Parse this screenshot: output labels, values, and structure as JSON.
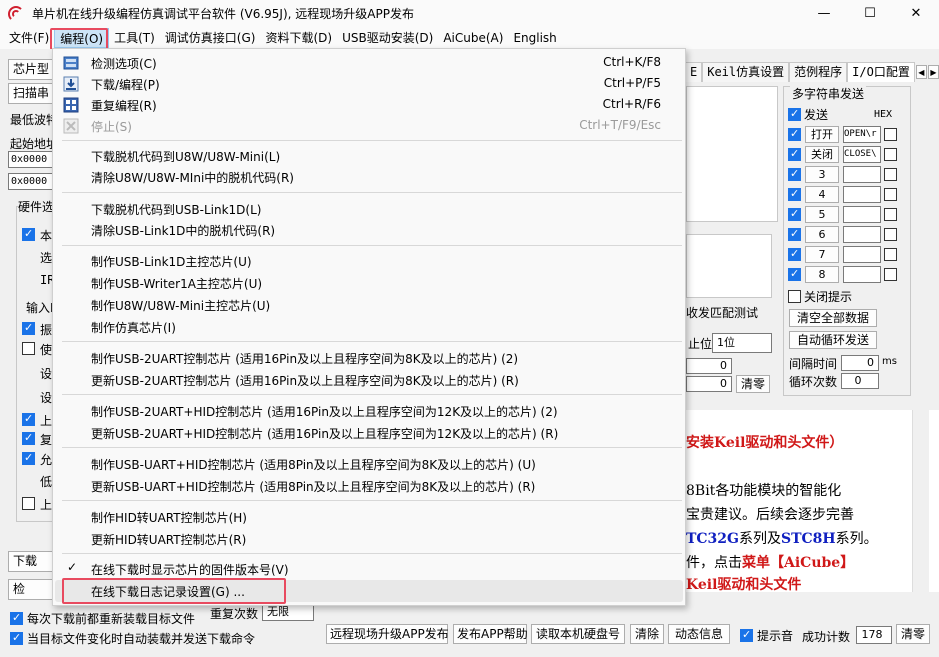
{
  "window": {
    "title": "单片机在线升级编程仿真调试平台软件 (V6.95J), 远程现场升级APP发布",
    "minimize_glyph": "—",
    "maximize_glyph": "☐",
    "close_glyph": "✕"
  },
  "menubar": [
    {
      "label": "文件(F)"
    },
    {
      "label": "编程(O)"
    },
    {
      "label": "工具(T)"
    },
    {
      "label": "调试仿真接口(G)"
    },
    {
      "label": "资料下载(D)"
    },
    {
      "label": "USB驱动安装(D)"
    },
    {
      "label": "AiCube(A)"
    },
    {
      "label": "English"
    }
  ],
  "left_panel": {
    "chip_label": "芯片型",
    "scan_label": "扫描串",
    "min_baud": "最低波特",
    "start_addr": "起始地址",
    "addr1": "0x0000",
    "addr2": "0x0000",
    "hw_group": "硬件选",
    "fragments": [
      "本",
      "选",
      "IR",
      "输入I",
      "振",
      "使",
      "设",
      "设",
      "上",
      "复",
      "允",
      "低",
      "上"
    ],
    "download_btn": "下载",
    "check_btn": "检"
  },
  "tabs": [
    "E",
    "Keil仿真设置",
    "范例程序",
    "I/O口配置"
  ],
  "tab_arrows": [
    "◀",
    "▶"
  ],
  "multistring": {
    "title": "多字符串发送",
    "send_label": "发送",
    "hex_label": "HEX",
    "rows": [
      {
        "btn": "打开",
        "value": "OPEN\\r"
      },
      {
        "btn": "关闭",
        "value": "CLOSE\\"
      },
      {
        "btn": "3",
        "value": ""
      },
      {
        "btn": "4",
        "value": ""
      },
      {
        "btn": "5",
        "value": ""
      },
      {
        "btn": "6",
        "value": ""
      },
      {
        "btn": "7",
        "value": ""
      },
      {
        "btn": "8",
        "value": ""
      }
    ],
    "close_hint": "关闭提示",
    "clear_all": "清空全部数据",
    "auto_loop": "自动循环发送",
    "interval_label": "间隔时间",
    "interval_value": "0",
    "interval_unit": "ms",
    "loop_label": "循环次数",
    "loop_value": "0"
  },
  "middle_right": {
    "trigger_text": "收发匹配测试",
    "stopbit_label": "止位",
    "stopbit_value": "1位",
    "count1": "0",
    "count2": "0",
    "clear": "清零"
  },
  "info": {
    "line1": "安装Keil驱动和头文件）",
    "line2": "8Bit各功能模块的智能化",
    "line3": "宝贵建议。后续会逐步完善",
    "line4_a": "TC32G",
    "line4_b": "系列及",
    "line4_c": "STC8H",
    "line4_d": "系列。",
    "line5_a": "件，点击",
    "line5_b": "菜单【AiCube】",
    "line6": "Keil驱动和头文件"
  },
  "bottom": {
    "reload_each": "每次下载前都重新装载目标文件",
    "auto_reload": "当目标文件变化时自动装载并发送下载命令",
    "repeat_label": "重复次数",
    "repeat_value": "无限",
    "buttons": [
      "远程现场升级APP发布",
      "发布APP帮助",
      "读取本机硬盘号",
      "清除",
      "动态信息"
    ],
    "beep": "提示音",
    "success_label": "成功计数",
    "success_value": "178",
    "clear": "清零"
  },
  "dropdown": {
    "items": [
      {
        "label": "检测选项(C)",
        "shortcut": "Ctrl+K/F8",
        "icon": "check-options-icon"
      },
      {
        "label": "下载/编程(P)",
        "shortcut": "Ctrl+P/F5",
        "icon": "download-icon"
      },
      {
        "label": "重复编程(R)",
        "shortcut": "Ctrl+R/F6",
        "icon": "repeat-program-icon"
      },
      {
        "label": "停止(S)",
        "shortcut": "Ctrl+T/F9/Esc",
        "icon": "stop-icon"
      },
      {
        "label": "下载脱机代码到U8W/U8W-Mini(L)",
        "shortcut": ""
      },
      {
        "label": "清除U8W/U8W-MIni中的脱机代码(R)",
        "shortcut": ""
      },
      {
        "label": "下载脱机代码到USB-Link1D(L)",
        "shortcut": ""
      },
      {
        "label": "清除USB-Link1D中的脱机代码(R)",
        "shortcut": ""
      },
      {
        "label": "制作USB-Link1D主控芯片(U)",
        "shortcut": ""
      },
      {
        "label": "制作USB-Writer1A主控芯片(U)",
        "shortcut": ""
      },
      {
        "label": "制作U8W/U8W-Mini主控芯片(U)",
        "shortcut": ""
      },
      {
        "label": "制作仿真芯片(I)",
        "shortcut": ""
      },
      {
        "label": "制作USB-2UART控制芯片 (适用16Pin及以上且程序空间为8K及以上的芯片) (2)",
        "shortcut": ""
      },
      {
        "label": "更新USB-2UART控制芯片 (适用16Pin及以上且程序空间为8K及以上的芯片) (R)",
        "shortcut": ""
      },
      {
        "label": "制作USB-2UART+HID控制芯片 (适用16Pin及以上且程序空间为12K及以上的芯片) (2)",
        "shortcut": ""
      },
      {
        "label": "更新USB-2UART+HID控制芯片 (适用16Pin及以上且程序空间为12K及以上的芯片) (R)",
        "shortcut": ""
      },
      {
        "label": "制作USB-UART+HID控制芯片 (适用8Pin及以上且程序空间为8K及以上的芯片) (U)",
        "shortcut": ""
      },
      {
        "label": "更新USB-UART+HID控制芯片 (适用8Pin及以上且程序空间为8K及以上的芯片) (R)",
        "shortcut": ""
      },
      {
        "label": "制作HID转UART控制芯片(H)",
        "shortcut": ""
      },
      {
        "label": "更新HID转UART控制芯片(R)",
        "shortcut": ""
      },
      {
        "label": "在线下载时显示芯片的固件版本号(V)",
        "shortcut": "",
        "checked": "✓"
      },
      {
        "label": "在线下载日志记录设置(G) ...",
        "shortcut": ""
      }
    ]
  },
  "colors": {
    "highlight": "#e84a5f",
    "checkbox_blue": "#1a73e8",
    "menu_active": "#cce4f7"
  }
}
